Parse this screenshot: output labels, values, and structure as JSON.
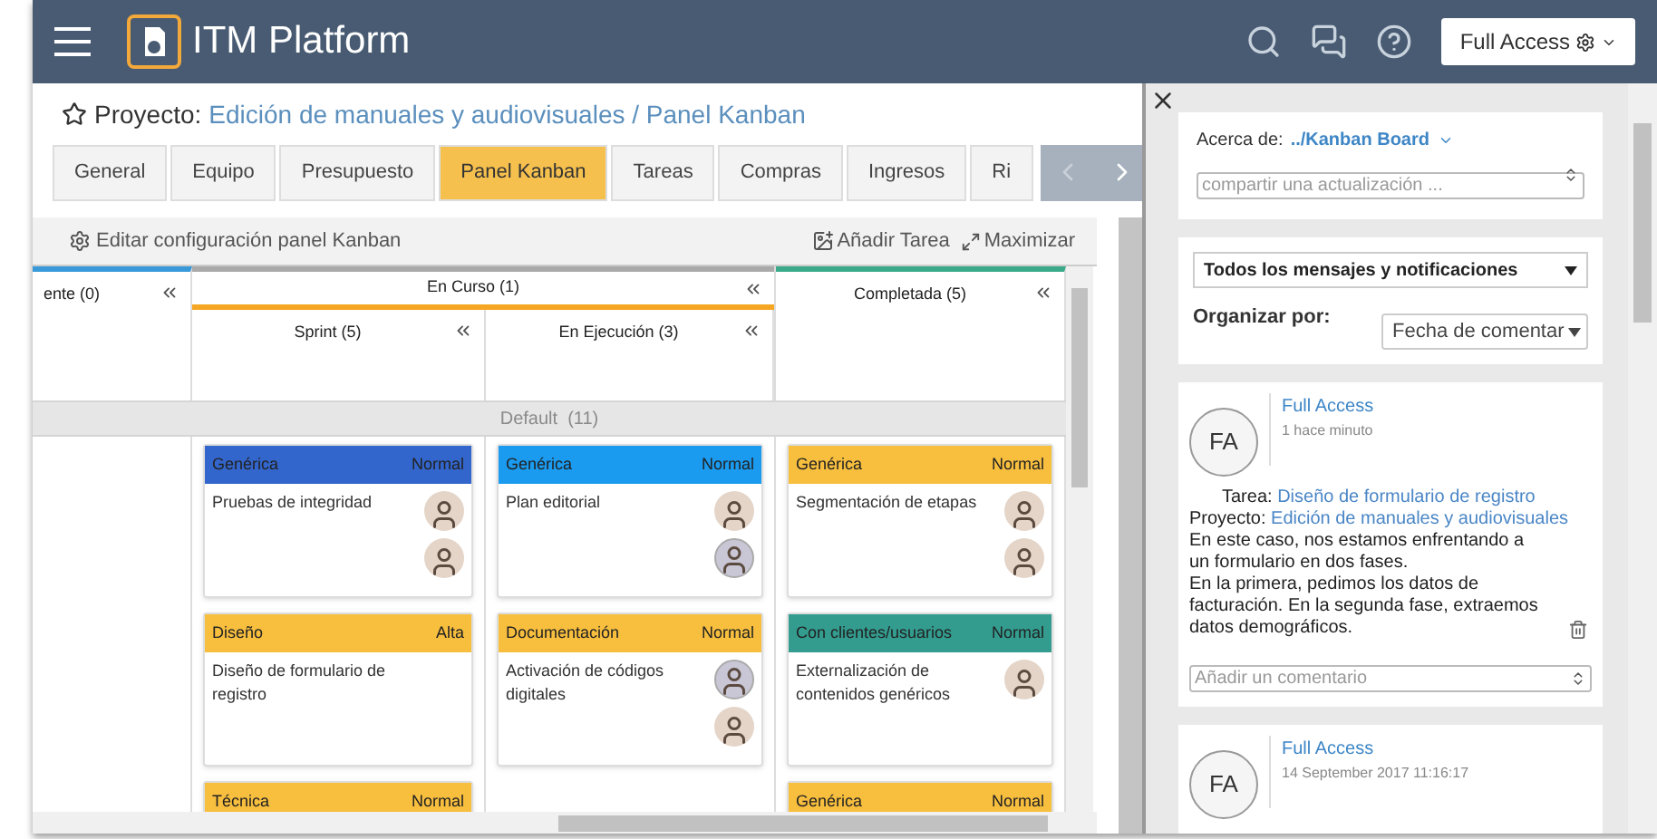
{
  "header": {
    "logo_text": "ITM Platform",
    "user_button": "Full Access"
  },
  "project": {
    "label": "Proyecto:",
    "path": "Edición de manuales y audiovisuales / Panel Kanban"
  },
  "tabs": [
    {
      "label": "General",
      "selected": false
    },
    {
      "label": "Equipo",
      "selected": false
    },
    {
      "label": "Presupuesto",
      "selected": false
    },
    {
      "label": "Panel Kanban",
      "selected": true
    },
    {
      "label": "Tareas",
      "selected": false
    },
    {
      "label": "Compras",
      "selected": false
    },
    {
      "label": "Ingresos",
      "selected": false
    },
    {
      "label": "Ri",
      "selected": false
    }
  ],
  "toolbar": {
    "edit": "Editar configuración panel Kanban",
    "add": "Añadir Tarea",
    "maximize": "Maximizar"
  },
  "board": {
    "swimlane": "Default  (11)",
    "columns": [
      {
        "title": "ente (0)",
        "color": "#3a9ad9"
      },
      {
        "title": "En Curso (1)",
        "color": "#f5a623",
        "children": [
          {
            "title": "Sprint (5)",
            "cards": [
              {
                "category": "Genérica",
                "priority": "Normal",
                "color": "#3366cc",
                "title": "Pruebas de integridad",
                "avatars": [
                  {
                    "kind": "photo"
                  },
                  {
                    "kind": "photo"
                  }
                ]
              },
              {
                "category": "Diseño",
                "priority": "Alta",
                "color": "#f8bf3f",
                "title": "Diseño de formulario de registro"
              },
              {
                "category": "Técnica",
                "priority": "Normal",
                "color": "#f8bf3f"
              }
            ]
          },
          {
            "title": "En Ejecución (3)",
            "cards": [
              {
                "category": "Genérica",
                "priority": "Normal",
                "color": "#1a9bf0",
                "title": "Plan editorial",
                "avatars": [
                  {
                    "kind": "photo"
                  },
                  {
                    "kind": "round"
                  }
                ]
              },
              {
                "category": "Documentación",
                "priority": "Normal",
                "color": "#f8bf3f",
                "title": "Activación de códigos digitales",
                "avatars": [
                  {
                    "kind": "round"
                  },
                  {
                    "kind": "photo"
                  }
                ]
              }
            ]
          }
        ]
      },
      {
        "title": "Completada (5)",
        "color": "#3aaa8a",
        "cards": [
          {
            "category": "Genérica",
            "priority": "Normal",
            "color": "#f8bf3f",
            "title": "Segmentación de etapas",
            "avatars": [
              {
                "kind": "photo"
              },
              {
                "kind": "photo"
              }
            ]
          },
          {
            "category": "Con clientes/usuarios",
            "priority": "Normal",
            "color": "#339c8f",
            "title": "Externalización de contenidos genéricos",
            "avatars": [
              {
                "kind": "photo"
              }
            ]
          },
          {
            "category": "Genérica",
            "priority": "Normal",
            "color": "#f8bf3f"
          }
        ]
      }
    ]
  },
  "activity": {
    "about_label": "Acerca de:",
    "about_link": "../Kanban Board",
    "share_placeholder": "compartir una actualización ...",
    "filter": "Todos los mensajes y notificaciones",
    "sort_label": "Organizar por:",
    "sort_value": "Fecha de comentar",
    "posts": [
      {
        "initials": "FA",
        "author": "Full Access",
        "time": "1 hace minuto",
        "task_label": "Tarea:",
        "task": "Diseño de formulario de registro",
        "project_label": "Proyecto:",
        "project": "Edición de manuales y audiovisuales",
        "body": "En este caso, nos estamos enfrentando a\nun formulario en dos fases.\nEn la primera, pedimos los datos de\nfacturación. En la segunda fase, extraemos\ndatos demográficos.",
        "comment_placeholder": "Añadir un comentario"
      },
      {
        "initials": "FA",
        "author": "Full Access",
        "time": "14 September 2017 11:16:17"
      }
    ]
  }
}
